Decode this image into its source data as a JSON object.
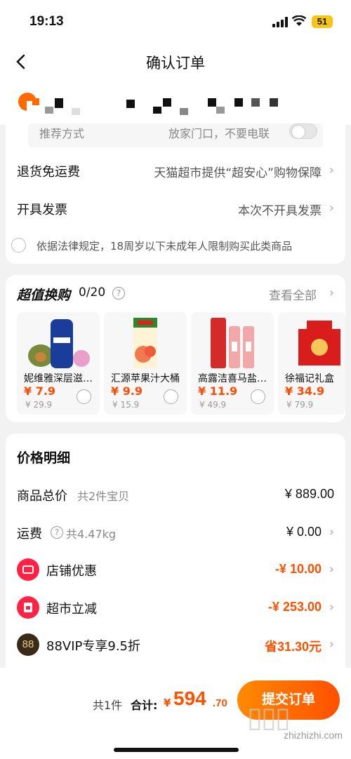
{
  "status": {
    "time": "19:13",
    "battery": "51"
  },
  "nav": {
    "title": "确认订单"
  },
  "delivery": {
    "label": "推荐方式",
    "value": "放家门口，不要电联"
  },
  "returns": {
    "label": "退货免运费",
    "value": "天猫超市提供“超安心”购物保障"
  },
  "invoice": {
    "label": "开具发票",
    "value": "本次不开具发票"
  },
  "legal": {
    "text": "依据法律规定，18周岁以下未成年人限制购买此类商品"
  },
  "deals": {
    "title": "超值换购",
    "count": "0/20",
    "view_all": "查看全部",
    "items": [
      {
        "name": "妮维雅深层滋润乳液",
        "price": "¥ 7.9",
        "original": "¥ 29.9",
        "icon": "lotion-bottle"
      },
      {
        "name": "汇源苹果汁大桶",
        "price": "¥ 9.9",
        "original": "¥ 15.9",
        "icon": "juice-carton"
      },
      {
        "name": "高露洁喜马盐牙膏",
        "price": "¥ 11.9",
        "original": "¥ 49.9",
        "icon": "toothpaste"
      },
      {
        "name": "徐福记礼盒",
        "price": "¥ 34.9",
        "original": "¥ 79.9",
        "icon": "gift-box"
      }
    ]
  },
  "price_detail": {
    "title": "价格明细",
    "goods_label": "商品总价",
    "goods_sub": "共2件宝贝",
    "goods_value": "¥ 889.00",
    "shipping_label": "运费",
    "shipping_sub": "共4.47kg",
    "shipping_value": "¥ 0.00",
    "store_discount_label": "店铺优惠",
    "store_discount_value": "-¥ 10.00",
    "market_discount_label": "超市立减",
    "market_discount_value": "-¥ 253.00",
    "vip_label": "88VIP专享9.5折",
    "vip_icon_text": "88",
    "vip_value": "省31.30元"
  },
  "footer": {
    "count": "共1件",
    "total_label": "合计:",
    "currency": "¥",
    "total_int": "594",
    "total_dec": ".70",
    "submit": "提交订单",
    "watermark": "zhizhizhi.com"
  },
  "colors": {
    "accent": "#ff5000",
    "red_icon": "#ff2244"
  }
}
